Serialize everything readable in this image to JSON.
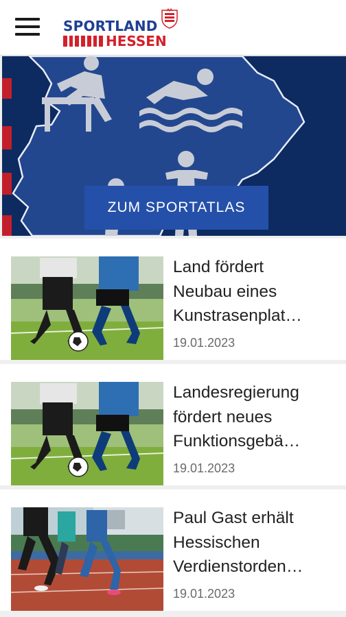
{
  "header": {
    "logo_line1": "SPORTLAND",
    "logo_line2": "HESSEN"
  },
  "hero": {
    "button_label": "ZUM SPORTATLAS"
  },
  "news": [
    {
      "title_lines": [
        "Land fördert",
        "Neubau eines",
        "Kunstrasenplat…"
      ],
      "date": "19.01.2023",
      "image_icon": "soccer-players-image"
    },
    {
      "title_lines": [
        "Landesregierung",
        "fördert neues",
        "Funktionsgebä…"
      ],
      "date": "19.01.2023",
      "image_icon": "soccer-players-image"
    },
    {
      "title_lines": [
        "Paul Gast erhält",
        "Hessischen",
        "Verdienstorden…"
      ],
      "date": "19.01.2023",
      "image_icon": "runners-image"
    }
  ],
  "colors": {
    "brand_blue": "#1f3f93",
    "brand_red": "#d3212a",
    "hero_bg": "#0d2b61",
    "hero_button": "#2450a9"
  }
}
